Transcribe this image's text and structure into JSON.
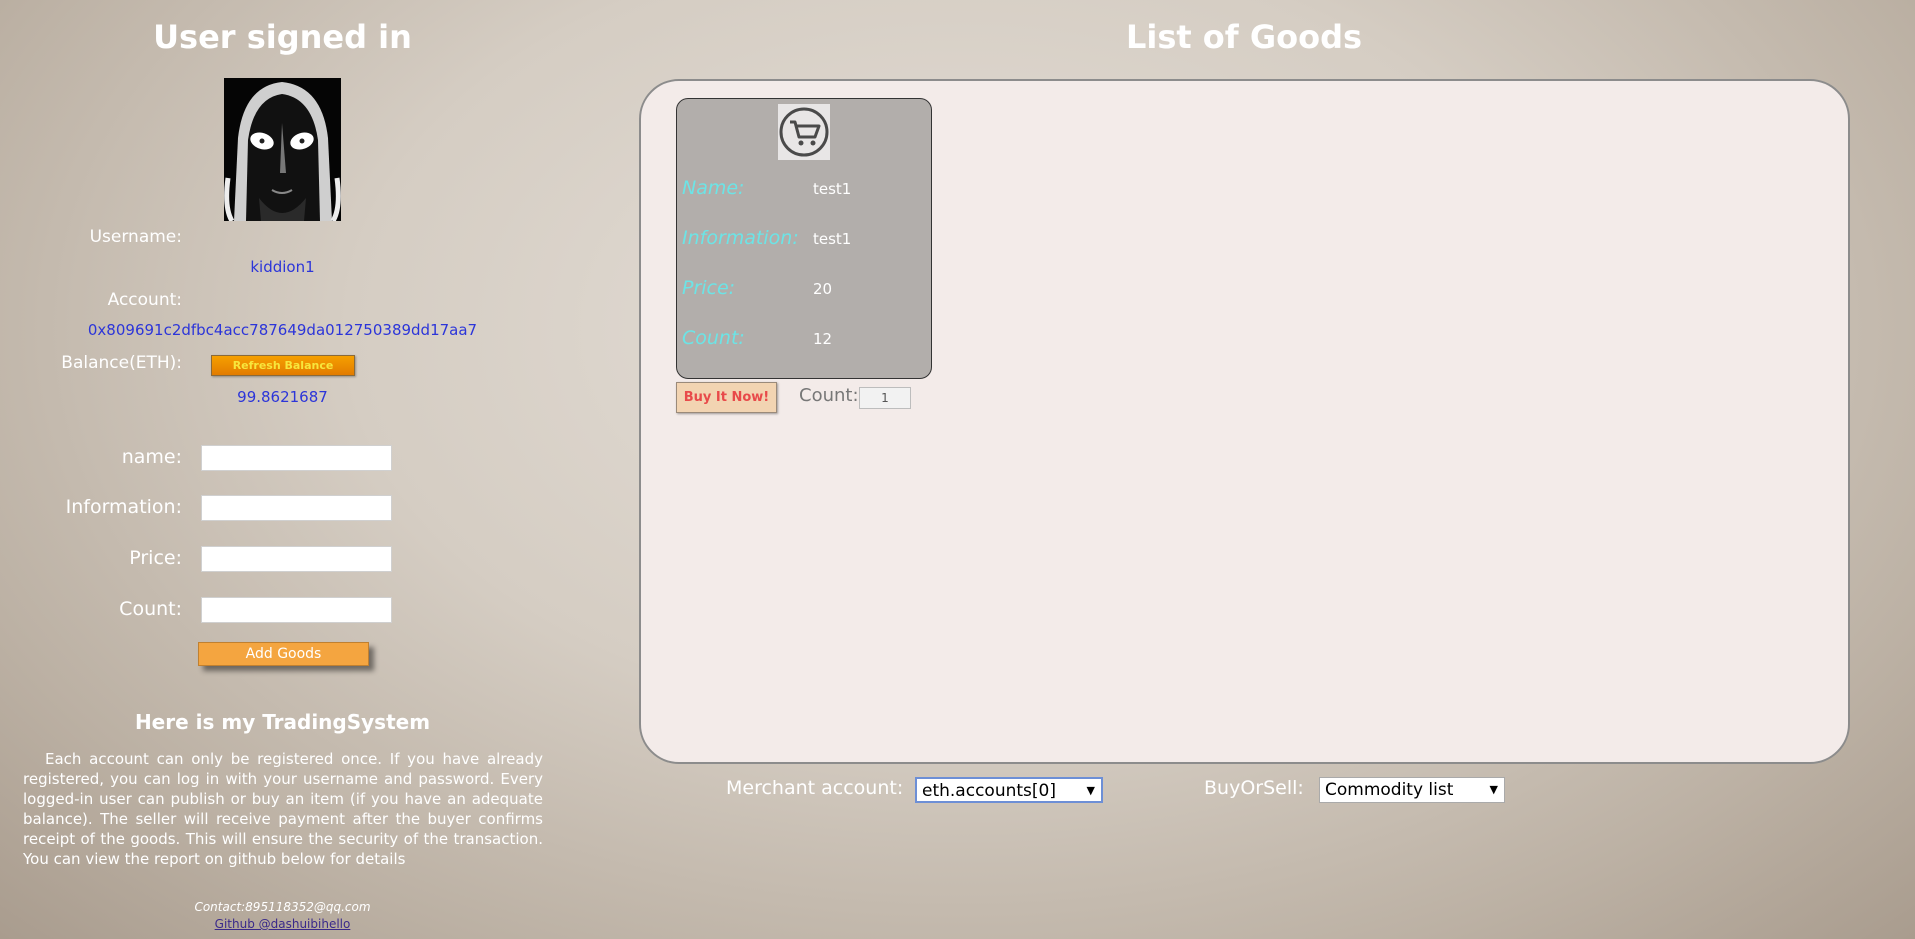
{
  "left": {
    "title": "User signed in",
    "username_label": "Username:",
    "username_value": "kiddion1",
    "account_label": "Account:",
    "account_value": "0x809691c2dfbc4acc787649da012750389dd17aa7",
    "balance_label": "Balance(ETH):",
    "refresh_button": "Refresh Balance",
    "balance_value": "99.8621687",
    "form": {
      "name_label": "name:",
      "information_label": "Information:",
      "price_label": "Price:",
      "count_label": "Count:",
      "add_button": "Add Goods"
    },
    "system_title": "Here is my TradingSystem",
    "system_text": "Each account can only be registered once. If you have already registered, you can log in with your username and password. Every logged-in user can publish or buy an item (if you have an adequate balance). The seller will receive payment after the buyer confirms receipt of the goods. This will ensure the security of the transaction. You can view the report on github below for details",
    "contact": "Contact:895118352@qq.com",
    "github": "Github @dashuibihello"
  },
  "right": {
    "title": "List of Goods",
    "goods": [
      {
        "icon": "shopping-cart-icon",
        "name_label": "Name:",
        "name": "test1",
        "information_label": "Information:",
        "information": "test1",
        "price_label": "Price:",
        "price": "20",
        "count_label": "Count:",
        "count": "12",
        "buy_button": "Buy It Now!",
        "buy_count_label": "Count:",
        "buy_count_value": "1"
      }
    ],
    "merchant_label": "Merchant account:",
    "merchant_selected": "eth.accounts[0]",
    "buyorsell_label": "BuyOrSell:",
    "buyorsell_selected": "Commodity list"
  },
  "colors": {
    "value_blue": "#2c35d9",
    "card_label_cyan": "#6ce4e6",
    "refresh_orange": "#f6a000",
    "add_orange": "#f4a540",
    "panel_bg": "#f3ebe9"
  }
}
